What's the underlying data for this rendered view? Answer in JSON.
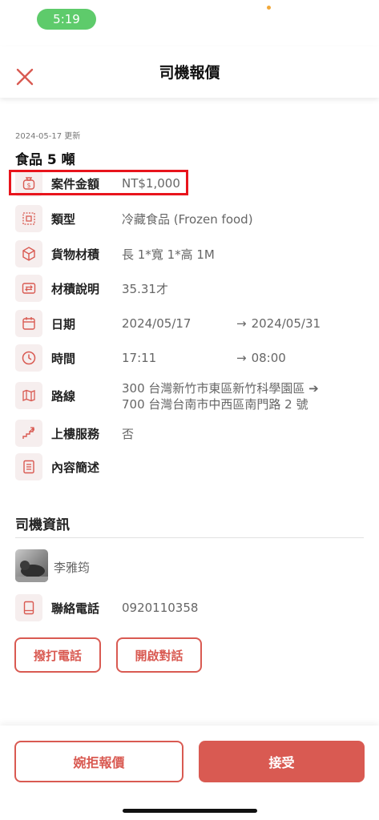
{
  "status_bar": {
    "time": "5:19"
  },
  "header": {
    "title": "司機報價"
  },
  "case": {
    "updated": "2024-05-17 更新",
    "title": "食品 5 噸"
  },
  "details": {
    "amount": {
      "label": "案件金額",
      "value": "NT$1,000"
    },
    "type": {
      "label": "類型",
      "value": "冷藏食品 (Frozen food)"
    },
    "volume": {
      "label": "貨物材積",
      "value": "長 1*寬 1*高 1M"
    },
    "volume_note": {
      "label": "材積說明",
      "value": "35.31才"
    },
    "date": {
      "label": "日期",
      "start": "2024/05/17",
      "arrow": "→",
      "end": "2024/05/31"
    },
    "time": {
      "label": "時間",
      "start": "17:11",
      "arrow": "→",
      "end": "08:00"
    },
    "route": {
      "label": "路線",
      "line1": "300 台灣新竹市東區新竹科學園區 ➔",
      "line2": "700 台灣台南市中西區南門路 2 號"
    },
    "upstairs": {
      "label": "上樓服務",
      "value": "否"
    },
    "description": {
      "label": "內容簡述"
    }
  },
  "driver": {
    "section_title": "司機資訊",
    "name": "李雅筠",
    "phone_label": "聯絡電話",
    "phone": "0920110358",
    "call_button": "撥打電話",
    "chat_button": "開啟對話"
  },
  "footer": {
    "decline_button": "婉拒報價",
    "accept_button": "接受"
  },
  "colors": {
    "accent": "#d95a52",
    "icon_bg": "#f6eeee",
    "highlight": "#e8141c",
    "status_green": "#5ecb6b"
  }
}
